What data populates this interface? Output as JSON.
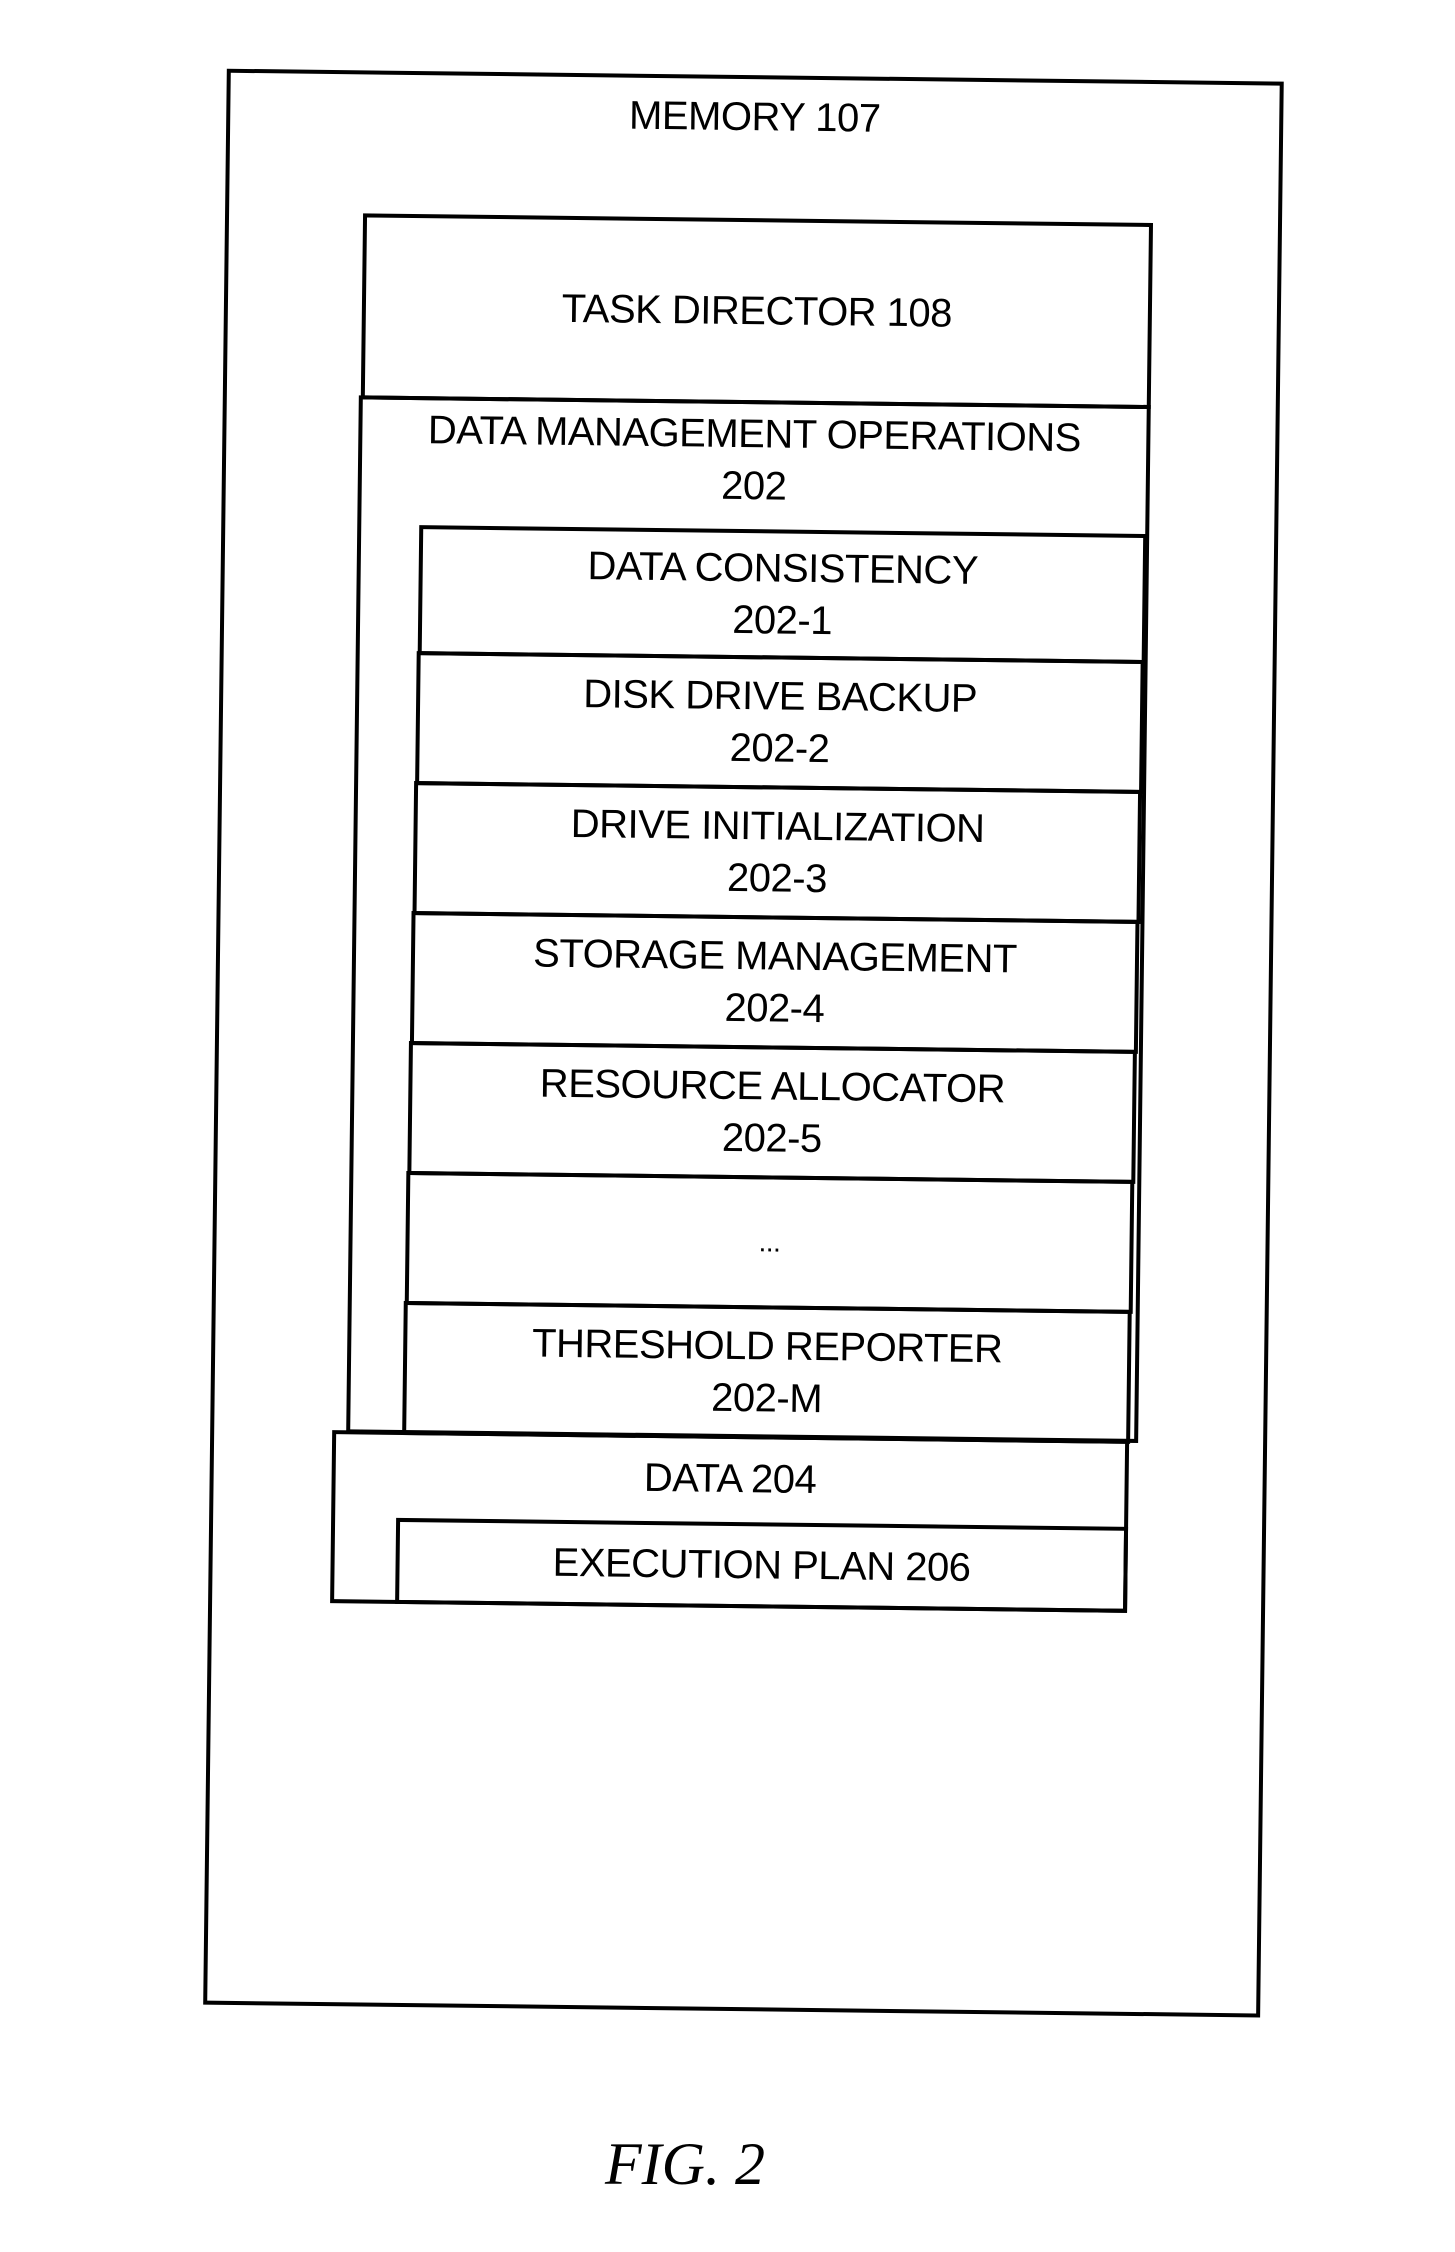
{
  "memory": {
    "label": "MEMORY 107"
  },
  "task_director": {
    "label": "TASK DIRECTOR 108"
  },
  "data_management_operations": {
    "title": "DATA MANAGEMENT OPERATIONS",
    "ref": "202",
    "items": [
      {
        "name": "DATA CONSISTENCY",
        "ref": "202-1"
      },
      {
        "name": "DISK DRIVE BACKUP",
        "ref": "202-2"
      },
      {
        "name": "DRIVE INITIALIZATION",
        "ref": "202-3"
      },
      {
        "name": "STORAGE MANAGEMENT",
        "ref": "202-4"
      },
      {
        "name": "RESOURCE ALLOCATOR",
        "ref": "202-5"
      },
      {
        "name": "...",
        "ref": ""
      },
      {
        "name": "THRESHOLD REPORTER",
        "ref": "202-M"
      }
    ]
  },
  "data": {
    "label": "DATA 204"
  },
  "execution_plan": {
    "label": "EXECUTION PLAN 206"
  },
  "caption": "FIG. 2"
}
